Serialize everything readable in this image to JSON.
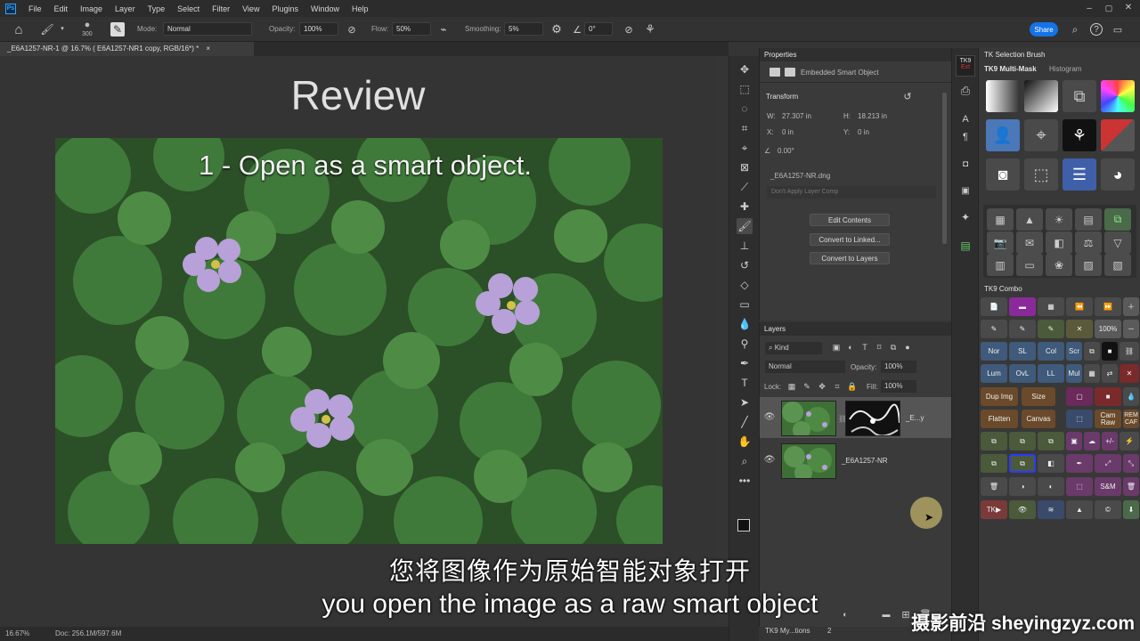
{
  "app": {
    "logo": "Ps"
  },
  "menu": [
    "File",
    "Edit",
    "Image",
    "Layer",
    "Type",
    "Select",
    "Filter",
    "View",
    "Plugins",
    "Window",
    "Help"
  ],
  "options_bar": {
    "brush_size": "300",
    "mode_label": "Mode:",
    "mode_value": "Normal",
    "opacity_label": "Opacity:",
    "opacity_value": "100%",
    "flow_label": "Flow:",
    "flow_value": "50%",
    "smoothing_label": "Smoothing:",
    "smoothing_value": "5%",
    "angle_value": "0°",
    "share_label": "Share"
  },
  "document_tab": {
    "title": "_E6A1257-NR-1 @ 16.7% ( E6A1257-NR1 copy, RGB/16*) *"
  },
  "slide": {
    "title": "Review",
    "subtitle": "1 - Open as a smart object."
  },
  "status": {
    "zoom": "16.67%",
    "doc": "Doc: 256.1M/597.6M"
  },
  "properties": {
    "header": "Properties",
    "kind": "Embedded Smart Object",
    "transform_label": "Transform",
    "w_label": "W:",
    "w_value": "27.307 in",
    "h_label": "H:",
    "h_value": "18.213 in",
    "x_label": "X:",
    "x_value": "0 in",
    "y_label": "Y:",
    "y_value": "0 in",
    "angle_value": "0.00°",
    "file_name": "_E6A1257-NR.dng",
    "layer_comp": "Don't Apply Layer Comp",
    "btn_edit": "Edit Contents",
    "btn_convert_linked": "Convert to Linked...",
    "btn_convert_layers": "Convert to Layers"
  },
  "layers": {
    "header": "Layers",
    "kind_label": "Kind",
    "blend": "Normal",
    "opacity_label": "Opacity:",
    "opacity_value": "100%",
    "lock_label": "Lock:",
    "fill_label": "Fill:",
    "fill_value": "100%",
    "rows": [
      {
        "name": "_E...y"
      },
      {
        "name": "_E6A1257-NR"
      }
    ]
  },
  "bottom_tabs": {
    "left": "TK9 My...tions",
    "left_count": "2"
  },
  "tk_strip": {
    "badge": "TK9",
    "sub": "Ext"
  },
  "tk_panel": {
    "selection_brush": "TK Selection Brush",
    "multimask": "TK9 Multi-Mask",
    "histogram": "Histogram",
    "combo_header": "TK9 Combo",
    "combo_text": {
      "pct": "100%",
      "nor": "Nor",
      "sl": "SL",
      "col": "Col",
      "scr": "Scr",
      "lum": "Lum",
      "ovl": "OvL",
      "ll": "LL",
      "mul": "Mul",
      "dupimg": "Dup Img",
      "size": "Size",
      "flatten": "Flatten",
      "canvas": "Canvas",
      "camraw": "Cam Raw",
      "remcaf": "REM CAF",
      "plusminus": "+/-",
      "sm": "S&M",
      "tk": "TK"
    }
  },
  "subtitles": {
    "cn": "您将图像作为原始智能对象打开",
    "en": "you open the image as a raw smart object"
  },
  "watermark": "摄影前沿 sheyingzyz.com"
}
